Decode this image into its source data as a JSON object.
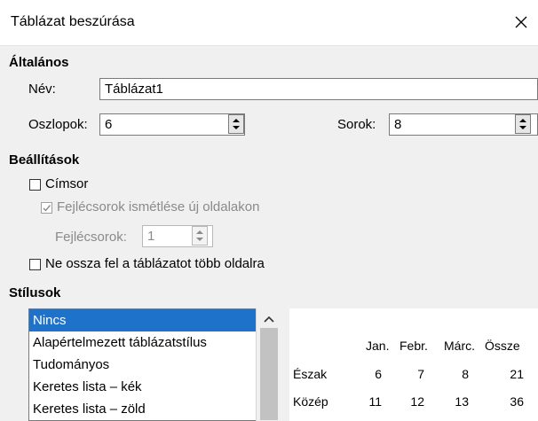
{
  "window": {
    "title": "Táblázat beszúrása",
    "close_icon": "close-icon"
  },
  "general": {
    "heading": "Általános",
    "name_label": "Név:",
    "name_value": "Táblázat1",
    "columns_label": "Oszlopok:",
    "columns_value": "6",
    "rows_label": "Sorok:",
    "rows_value": "8"
  },
  "options": {
    "heading": "Beállítások",
    "heading_row": {
      "label": "Címsor",
      "checked": false
    },
    "repeat_heading": {
      "label": "Fejlécsorok ismétlése új oldalakon",
      "checked": true,
      "enabled": false
    },
    "heading_rows_label": "Fejlécsorok:",
    "heading_rows_value": "1",
    "dont_split": {
      "label": "Ne ossza fel a táblázatot több oldalra",
      "checked": false
    }
  },
  "styles": {
    "heading": "Stílusok",
    "items": [
      "Nincs",
      "Alapértelmezett táblázatstílus",
      "Tudományos",
      "Keretes lista – kék",
      "Keretes lista – zöld"
    ],
    "selected_index": 0,
    "selection_color": "#1f72c9"
  },
  "preview": {
    "headers": [
      "Jan.",
      "Febr.",
      "Márc.",
      "Össze"
    ],
    "rows": [
      {
        "label": "Észak",
        "values": [
          "6",
          "7",
          "8",
          "21"
        ]
      },
      {
        "label": "Közép",
        "values": [
          "11",
          "12",
          "13",
          "36"
        ]
      }
    ]
  }
}
